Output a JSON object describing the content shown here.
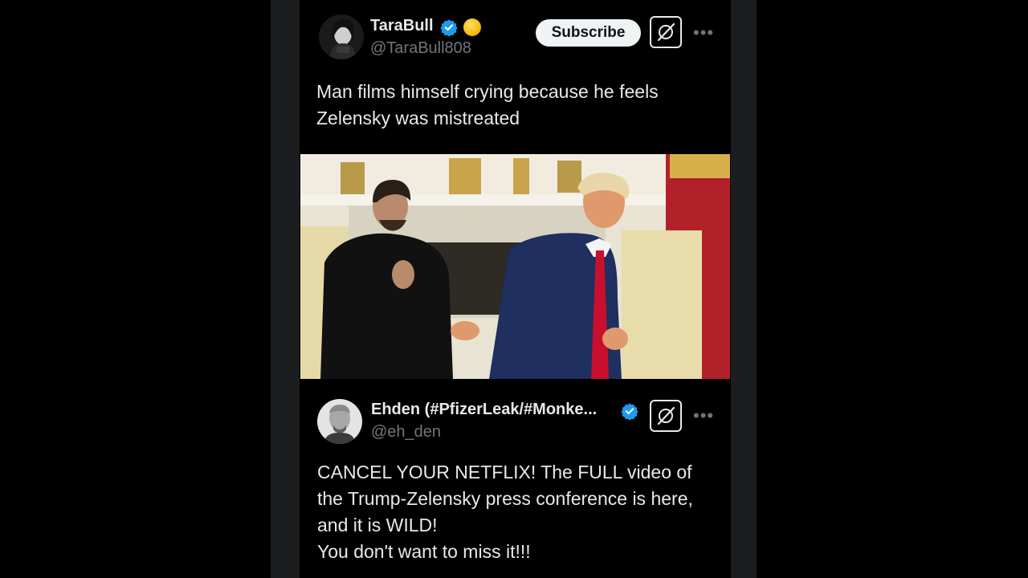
{
  "tweet": {
    "author_name": "TaraBull",
    "author_handle": "@TaraBull808",
    "subscribe_label": "Subscribe",
    "more_glyph": "•••",
    "text_line1": "Man films himself crying because he feels",
    "text_line2": "Zelensky was mistreated"
  },
  "quoted": {
    "author_name": "Ehden (#PfizerLeak/#Monke...",
    "author_handle": "@eh_den",
    "more_glyph": "•••",
    "text_line1": "CANCEL YOUR NETFLIX! The FULL video of",
    "text_line2": "the Trump-Zelensky press conference is here,",
    "text_line3": "and it is WILD!",
    "text_line4": "You don't want to miss it!!!"
  },
  "colors": {
    "background": "#000000",
    "side_bars": "#1c1d1f",
    "verified_blue": "#1d9bf0",
    "secondary_text": "#71767b",
    "button_bg": "#eff3f4"
  },
  "icons": {
    "verified": "verified-badge-icon",
    "coin": "gold-coin-icon",
    "grok": "grok-icon",
    "more": "more-options-icon"
  }
}
